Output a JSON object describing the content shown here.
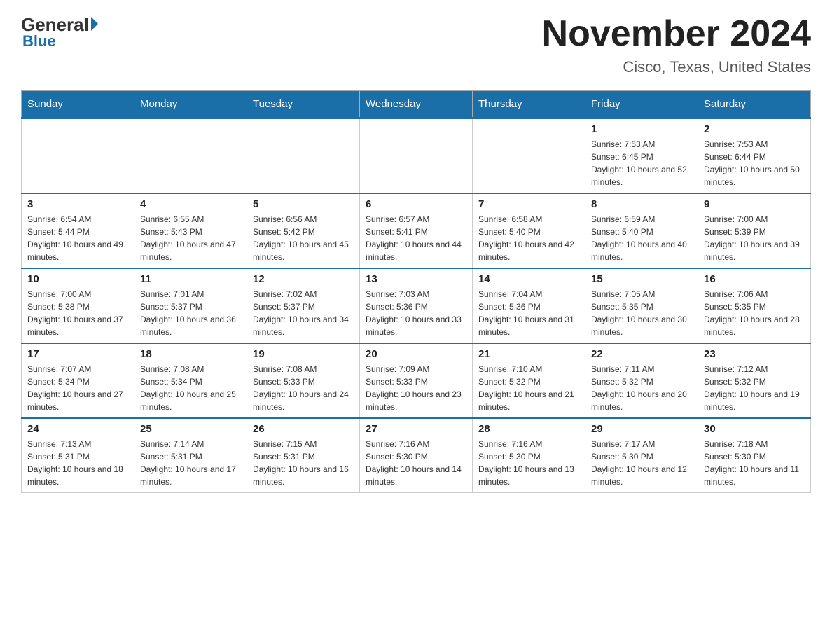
{
  "logo": {
    "general": "General",
    "blue": "Blue",
    "tagline": "Blue"
  },
  "header": {
    "title": "November 2024",
    "location": "Cisco, Texas, United States"
  },
  "days_of_week": [
    "Sunday",
    "Monday",
    "Tuesday",
    "Wednesday",
    "Thursday",
    "Friday",
    "Saturday"
  ],
  "weeks": [
    [
      {
        "day": "",
        "info": ""
      },
      {
        "day": "",
        "info": ""
      },
      {
        "day": "",
        "info": ""
      },
      {
        "day": "",
        "info": ""
      },
      {
        "day": "",
        "info": ""
      },
      {
        "day": "1",
        "info": "Sunrise: 7:53 AM\nSunset: 6:45 PM\nDaylight: 10 hours and 52 minutes."
      },
      {
        "day": "2",
        "info": "Sunrise: 7:53 AM\nSunset: 6:44 PM\nDaylight: 10 hours and 50 minutes."
      }
    ],
    [
      {
        "day": "3",
        "info": "Sunrise: 6:54 AM\nSunset: 5:44 PM\nDaylight: 10 hours and 49 minutes."
      },
      {
        "day": "4",
        "info": "Sunrise: 6:55 AM\nSunset: 5:43 PM\nDaylight: 10 hours and 47 minutes."
      },
      {
        "day": "5",
        "info": "Sunrise: 6:56 AM\nSunset: 5:42 PM\nDaylight: 10 hours and 45 minutes."
      },
      {
        "day": "6",
        "info": "Sunrise: 6:57 AM\nSunset: 5:41 PM\nDaylight: 10 hours and 44 minutes."
      },
      {
        "day": "7",
        "info": "Sunrise: 6:58 AM\nSunset: 5:40 PM\nDaylight: 10 hours and 42 minutes."
      },
      {
        "day": "8",
        "info": "Sunrise: 6:59 AM\nSunset: 5:40 PM\nDaylight: 10 hours and 40 minutes."
      },
      {
        "day": "9",
        "info": "Sunrise: 7:00 AM\nSunset: 5:39 PM\nDaylight: 10 hours and 39 minutes."
      }
    ],
    [
      {
        "day": "10",
        "info": "Sunrise: 7:00 AM\nSunset: 5:38 PM\nDaylight: 10 hours and 37 minutes."
      },
      {
        "day": "11",
        "info": "Sunrise: 7:01 AM\nSunset: 5:37 PM\nDaylight: 10 hours and 36 minutes."
      },
      {
        "day": "12",
        "info": "Sunrise: 7:02 AM\nSunset: 5:37 PM\nDaylight: 10 hours and 34 minutes."
      },
      {
        "day": "13",
        "info": "Sunrise: 7:03 AM\nSunset: 5:36 PM\nDaylight: 10 hours and 33 minutes."
      },
      {
        "day": "14",
        "info": "Sunrise: 7:04 AM\nSunset: 5:36 PM\nDaylight: 10 hours and 31 minutes."
      },
      {
        "day": "15",
        "info": "Sunrise: 7:05 AM\nSunset: 5:35 PM\nDaylight: 10 hours and 30 minutes."
      },
      {
        "day": "16",
        "info": "Sunrise: 7:06 AM\nSunset: 5:35 PM\nDaylight: 10 hours and 28 minutes."
      }
    ],
    [
      {
        "day": "17",
        "info": "Sunrise: 7:07 AM\nSunset: 5:34 PM\nDaylight: 10 hours and 27 minutes."
      },
      {
        "day": "18",
        "info": "Sunrise: 7:08 AM\nSunset: 5:34 PM\nDaylight: 10 hours and 25 minutes."
      },
      {
        "day": "19",
        "info": "Sunrise: 7:08 AM\nSunset: 5:33 PM\nDaylight: 10 hours and 24 minutes."
      },
      {
        "day": "20",
        "info": "Sunrise: 7:09 AM\nSunset: 5:33 PM\nDaylight: 10 hours and 23 minutes."
      },
      {
        "day": "21",
        "info": "Sunrise: 7:10 AM\nSunset: 5:32 PM\nDaylight: 10 hours and 21 minutes."
      },
      {
        "day": "22",
        "info": "Sunrise: 7:11 AM\nSunset: 5:32 PM\nDaylight: 10 hours and 20 minutes."
      },
      {
        "day": "23",
        "info": "Sunrise: 7:12 AM\nSunset: 5:32 PM\nDaylight: 10 hours and 19 minutes."
      }
    ],
    [
      {
        "day": "24",
        "info": "Sunrise: 7:13 AM\nSunset: 5:31 PM\nDaylight: 10 hours and 18 minutes."
      },
      {
        "day": "25",
        "info": "Sunrise: 7:14 AM\nSunset: 5:31 PM\nDaylight: 10 hours and 17 minutes."
      },
      {
        "day": "26",
        "info": "Sunrise: 7:15 AM\nSunset: 5:31 PM\nDaylight: 10 hours and 16 minutes."
      },
      {
        "day": "27",
        "info": "Sunrise: 7:16 AM\nSunset: 5:30 PM\nDaylight: 10 hours and 14 minutes."
      },
      {
        "day": "28",
        "info": "Sunrise: 7:16 AM\nSunset: 5:30 PM\nDaylight: 10 hours and 13 minutes."
      },
      {
        "day": "29",
        "info": "Sunrise: 7:17 AM\nSunset: 5:30 PM\nDaylight: 10 hours and 12 minutes."
      },
      {
        "day": "30",
        "info": "Sunrise: 7:18 AM\nSunset: 5:30 PM\nDaylight: 10 hours and 11 minutes."
      }
    ]
  ]
}
